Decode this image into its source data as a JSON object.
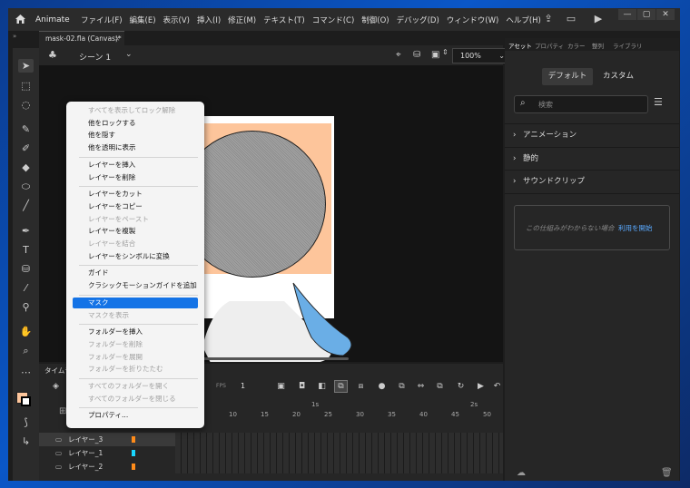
{
  "app": {
    "name": "Animate"
  },
  "menu": [
    "ファイル(F)",
    "編集(E)",
    "表示(V)",
    "挿入(I)",
    "修正(M)",
    "テキスト(T)",
    "コマンド(C)",
    "制御(O)",
    "デバッグ(D)",
    "ウィンドウ(W)",
    "ヘルプ(H)"
  ],
  "window_controls": {
    "min": "—",
    "max": "▢",
    "close": "✕"
  },
  "document_tab": {
    "label": "mask-02.fla (Canvas)*",
    "close": "×"
  },
  "stage_header": {
    "scene": "シーン 1",
    "zoom": "100%"
  },
  "timeline": {
    "title": "タイムライン",
    "fps_label": "FPS",
    "frame_indicator": "1",
    "ruler_labels": [
      "1s",
      "2s"
    ],
    "ruler_numbers": [
      "10",
      "15",
      "20",
      "25",
      "30",
      "35",
      "40",
      "45",
      "50"
    ],
    "layers": [
      {
        "name": "レイヤー_3",
        "color": "#ff8c1a",
        "selected": true
      },
      {
        "name": "レイヤー_1",
        "color": "#19d6ff",
        "selected": false
      },
      {
        "name": "レイヤー_2",
        "color": "#ff8c1a",
        "selected": false
      }
    ]
  },
  "right_panel": {
    "tabs": [
      "アセット",
      "プロパティ",
      "カラー",
      "整列",
      "ライブラリ"
    ],
    "segments": {
      "default": "デフォルト",
      "custom": "カスタム"
    },
    "search_placeholder": "検索",
    "sections": [
      "アニメーション",
      "静的",
      "サウンドクリップ"
    ],
    "help": {
      "text": "この仕組みがわからない場合",
      "link": "利用を開始"
    }
  },
  "context_menu": [
    {
      "label": "すべてを表示してロック解除",
      "enabled": false
    },
    {
      "label": "他をロックする",
      "enabled": true
    },
    {
      "label": "他を隠す",
      "enabled": true
    },
    {
      "label": "他を透明に表示",
      "enabled": true
    },
    {
      "sep": true
    },
    {
      "label": "レイヤーを挿入",
      "enabled": true
    },
    {
      "label": "レイヤーを削除",
      "enabled": true
    },
    {
      "sep": true
    },
    {
      "label": "レイヤーをカット",
      "enabled": true
    },
    {
      "label": "レイヤーをコピー",
      "enabled": true
    },
    {
      "label": "レイヤーをペースト",
      "enabled": false
    },
    {
      "label": "レイヤーを複製",
      "enabled": true
    },
    {
      "label": "レイヤーを結合",
      "enabled": false
    },
    {
      "label": "レイヤーをシンボルに変換",
      "enabled": true
    },
    {
      "sep": true
    },
    {
      "label": "ガイド",
      "enabled": true
    },
    {
      "label": "クラシックモーションガイドを追加",
      "enabled": true
    },
    {
      "sep": true
    },
    {
      "label": "マスク",
      "enabled": true,
      "highlighted": true
    },
    {
      "label": "マスクを表示",
      "enabled": false
    },
    {
      "sep": true
    },
    {
      "label": "フォルダーを挿入",
      "enabled": true
    },
    {
      "label": "フォルダーを削除",
      "enabled": false
    },
    {
      "label": "フォルダーを展開",
      "enabled": false
    },
    {
      "label": "フォルダーを折りたたむ",
      "enabled": false
    },
    {
      "sep": true
    },
    {
      "label": "すべてのフォルダーを開く",
      "enabled": false
    },
    {
      "label": "すべてのフォルダーを閉じる",
      "enabled": false
    },
    {
      "sep": true
    },
    {
      "label": "プロパティ...",
      "enabled": true
    }
  ],
  "colors": {
    "fill": "#fdc59b",
    "stroke": "#000000",
    "accent": "#1473e6",
    "mask_shape": "#9a9a9a",
    "character_blue": "#6aaee6"
  }
}
